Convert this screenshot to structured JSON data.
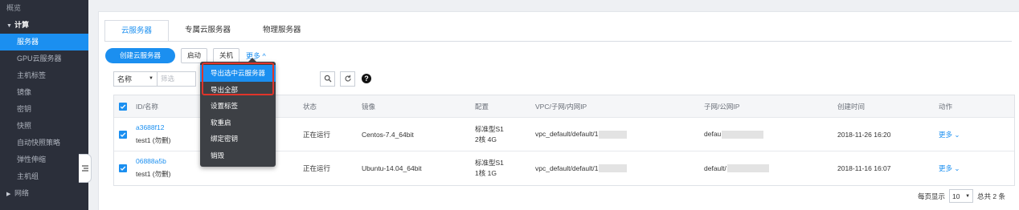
{
  "sidebar": {
    "items": [
      {
        "label": "概览",
        "type": "sub"
      },
      {
        "label": "计算",
        "type": "group"
      },
      {
        "label": "服务器",
        "type": "active"
      },
      {
        "label": "GPU云服务器",
        "type": "item"
      },
      {
        "label": "主机标签",
        "type": "item"
      },
      {
        "label": "镜像",
        "type": "item"
      },
      {
        "label": "密钥",
        "type": "item"
      },
      {
        "label": "快照",
        "type": "item"
      },
      {
        "label": "自动快照策略",
        "type": "item"
      },
      {
        "label": "弹性伸缩",
        "type": "item"
      },
      {
        "label": "主机组",
        "type": "item"
      },
      {
        "label": "网络",
        "type": "group-collapsed"
      }
    ]
  },
  "tabs": [
    "云服务器",
    "专属云服务器",
    "物理服务器"
  ],
  "toolbar": {
    "create": "创建云服务器",
    "start": "启动",
    "stop": "关机",
    "more": "更多 ^"
  },
  "search": {
    "field": "名称",
    "placeholder": "筛选"
  },
  "dropdown": [
    "导出选中云服务器",
    "导出全部",
    "设置标签",
    "软重启",
    "绑定密钥",
    "销毁"
  ],
  "table": {
    "headers": [
      "ID/名称",
      "",
      "状态",
      "镜像",
      "配置",
      "VPC/子网/内网IP",
      "子网/公网IP",
      "创建时间",
      "动作"
    ],
    "rows": [
      {
        "id": "a3688f12",
        "name": "test1 (勿删)",
        "status": "正在运行",
        "image": "Centos-7.4_64bit",
        "config_1": "标准型S1",
        "config_2": "2核 4G",
        "vpc": "vpc_default/default/1",
        "subnet": "defau",
        "created": "2018-11-26 16:20",
        "action": "更多 ⌄"
      },
      {
        "id": "06888a5b",
        "name": "test1 (勿删)",
        "status": "正在运行",
        "image": "Ubuntu-14.04_64bit",
        "config_1": "标准型S1",
        "config_2": "1核 1G",
        "vpc": "vpc_default/default/1",
        "subnet": "default/",
        "created": "2018-11-16 16:07",
        "action": "更多 ⌄"
      }
    ]
  },
  "pager": {
    "label": "每页显示",
    "size": "10",
    "total": "总共 2 条"
  }
}
